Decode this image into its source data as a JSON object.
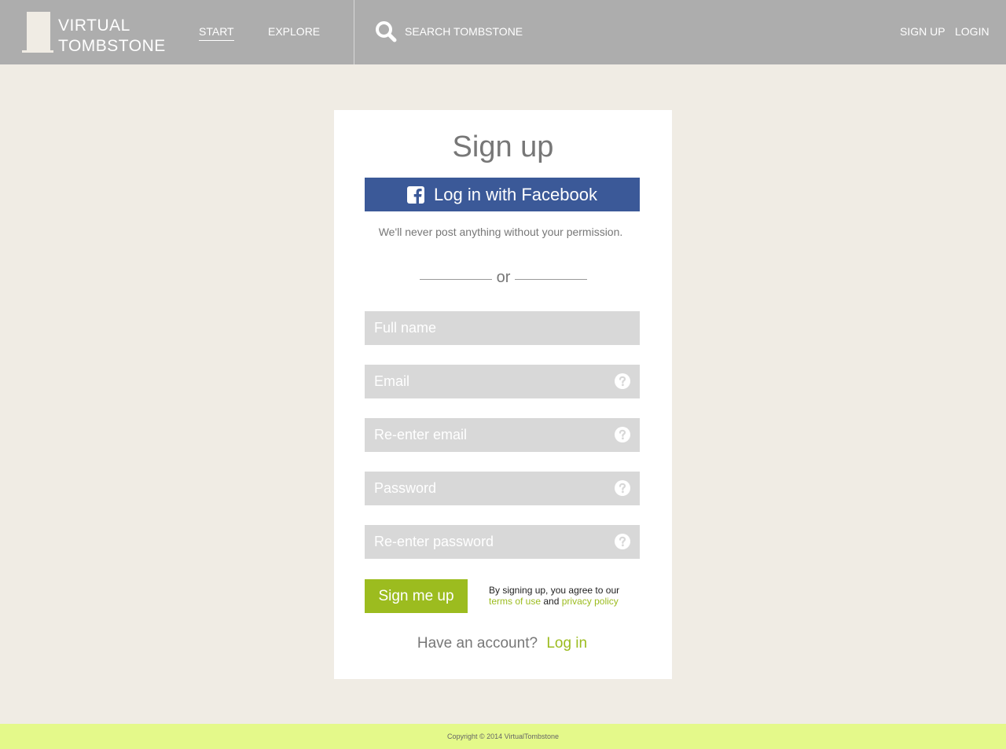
{
  "header": {
    "logo_line1": "VIRTUAL",
    "logo_line2": "TOMBSTONE",
    "nav_start": "START",
    "nav_explore": "EXPLORE",
    "search_placeholder": "SEARCH TOMBSTONE",
    "nav_signup": "SIGN UP",
    "nav_login": "LOGIN"
  },
  "form": {
    "title": "Sign up",
    "facebook_label": "Log in with Facebook",
    "permission_note": "We'll never post anything without your permission.",
    "or_label": "or",
    "fields": {
      "full_name": "Full name",
      "email": "Email",
      "reenter_email": "Re-enter email",
      "password": "Password",
      "reenter_password": "Re-enter password"
    },
    "submit_label": "Sign me up",
    "terms_prefix": "By signing up, you agree to our",
    "terms_link": "terms of use",
    "terms_and": "and",
    "privacy_link": "privacy policy",
    "have_account": "Have an account?",
    "login_link": "Log in"
  },
  "footer": {
    "copyright": "Copyright © 2014 VirtualTombstone"
  },
  "colors": {
    "header_bg": "#adadad",
    "page_bg": "#f0ece4",
    "facebook": "#3b5998",
    "accent_green": "#9cbc1f",
    "footer_bg": "#e4f98a",
    "field_bg": "#d8d8d8"
  },
  "icons": {
    "logo": "tombstone-logo-icon",
    "search": "search-icon",
    "facebook": "facebook-icon",
    "help": "help-icon"
  }
}
